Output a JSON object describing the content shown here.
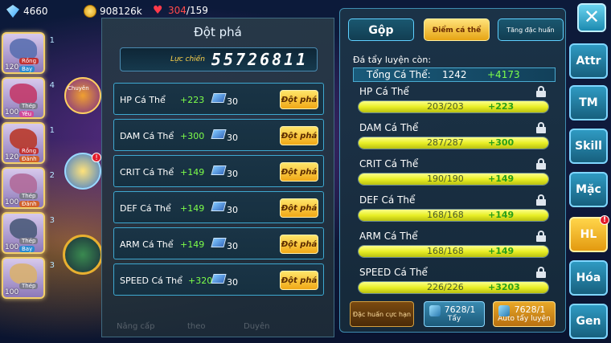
{
  "resources": {
    "gems": "4660",
    "gold": "908126k",
    "hp_current": "304",
    "hp_max": "/159"
  },
  "heroes": [
    {
      "num": "1",
      "level": "120",
      "tag1": "Rồng",
      "tag2": "Bay",
      "color": "#5a6fb0"
    },
    {
      "num": "4",
      "level": "100",
      "tag1": "Thép",
      "tag2": "Yêu",
      "color": "#c23a6a"
    },
    {
      "num": "1",
      "level": "120",
      "tag1": "Rồng",
      "tag2": "Đánh",
      "color": "#b8382a"
    },
    {
      "num": "2",
      "level": "100",
      "tag1": "Thép",
      "tag2": "Đánh",
      "color": "#b06a9a"
    },
    {
      "num": "3",
      "level": "100",
      "tag1": "Thép",
      "tag2": "Bay",
      "color": "#4a5a7a"
    },
    {
      "num": "3",
      "level": "100",
      "tag1": "Thép",
      "tag2": "",
      "color": "#d8b070"
    }
  ],
  "side_label": "Chuyên",
  "side_badge": "!",
  "dotpha": {
    "title": "Đột phá",
    "power_label": "Lực chiến",
    "power_value": "55726811",
    "button_label": "Đột phá",
    "rows": [
      {
        "stat": "HP Cá Thể",
        "bonus": "+223",
        "cost": "30"
      },
      {
        "stat": "DAM Cá Thể",
        "bonus": "+300",
        "cost": "30"
      },
      {
        "stat": "CRIT Cá Thể",
        "bonus": "+149",
        "cost": "30"
      },
      {
        "stat": "DEF Cá Thể",
        "bonus": "+149",
        "cost": "30"
      },
      {
        "stat": "ARM Cá Thể",
        "bonus": "+149",
        "cost": "30"
      },
      {
        "stat": "SPEED Cá Thể",
        "bonus": "+3203",
        "cost": "30"
      }
    ],
    "bottom_labels": [
      "Nâng cấp",
      "theo",
      "Duyên"
    ]
  },
  "tabs": {
    "gop": "Gộp",
    "diem": "Điểm cá thể",
    "tang": "Tăng đặc huấn"
  },
  "remain_label": "Đá tẩy luyện còn:",
  "total": {
    "label": "Tổng Cá Thể:",
    "value": "1242",
    "add": "+4173"
  },
  "stats": [
    {
      "name": "HP Cá Thể",
      "value": "203/203",
      "add": "+223",
      "fill": 1.0
    },
    {
      "name": "DAM Cá Thể",
      "value": "287/287",
      "add": "+300",
      "fill": 1.0
    },
    {
      "name": "CRIT Cá Thể",
      "value": "190/190",
      "add": "+149",
      "fill": 1.0
    },
    {
      "name": "DEF Cá Thể",
      "value": "168/168",
      "add": "+149",
      "fill": 1.0
    },
    {
      "name": "ARM Cá Thể",
      "value": "168/168",
      "add": "+149",
      "fill": 1.0
    },
    {
      "name": "SPEED Cá Thể",
      "value": "226/226",
      "add": "+3203",
      "fill": 1.0
    }
  ],
  "actions": {
    "dachuan": "Đặc huấn cực hạn",
    "tay_count": "7628/1",
    "tay_label": "Tẩy",
    "auto_count": "7628/1",
    "auto_label": "Auto tẩy luyện"
  },
  "right_nav": [
    "Attr",
    "TM",
    "Skill",
    "Mặc",
    "HL",
    "Hóa",
    "Gen"
  ],
  "hl_badge": "!"
}
